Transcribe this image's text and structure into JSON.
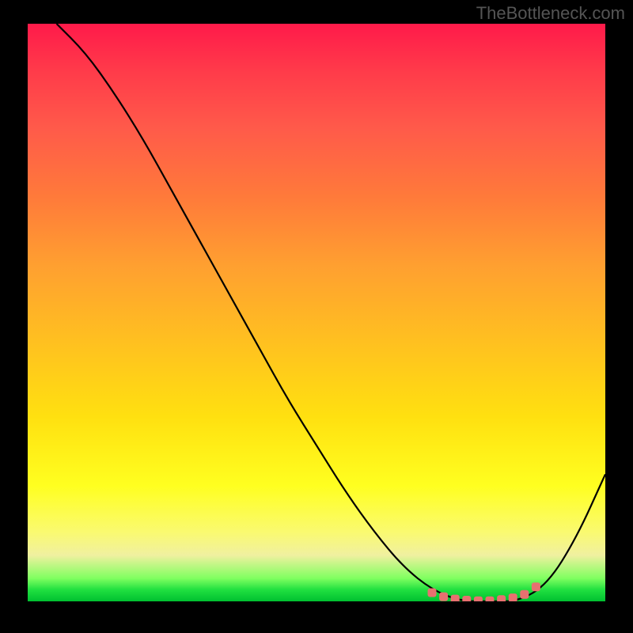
{
  "watermark": "TheBottleneck.com",
  "chart_data": {
    "type": "line",
    "title": "",
    "xlabel": "",
    "ylabel": "",
    "xlim": [
      0,
      100
    ],
    "ylim": [
      0,
      100
    ],
    "grid": false,
    "legend": false,
    "background_gradient": {
      "top": "#ff1a4a",
      "mid": "#ffff20",
      "bottom": "#00c030"
    },
    "series": [
      {
        "name": "curve",
        "color": "#000000",
        "x": [
          5,
          10,
          15,
          20,
          25,
          30,
          35,
          40,
          45,
          50,
          55,
          60,
          65,
          70,
          75,
          80,
          85,
          90,
          95,
          100
        ],
        "y": [
          100,
          95,
          88,
          80,
          71,
          62,
          53,
          44,
          35,
          27,
          19,
          12,
          6,
          2,
          0,
          0,
          0,
          3,
          11,
          22
        ]
      }
    ],
    "markers": {
      "name": "optimal-range",
      "color": "#e87070",
      "shape": "rounded-square",
      "x": [
        70,
        72,
        74,
        76,
        78,
        80,
        82,
        84,
        86,
        88
      ],
      "y": [
        1.5,
        0.8,
        0.4,
        0.2,
        0.1,
        0.1,
        0.3,
        0.6,
        1.2,
        2.5
      ]
    }
  }
}
